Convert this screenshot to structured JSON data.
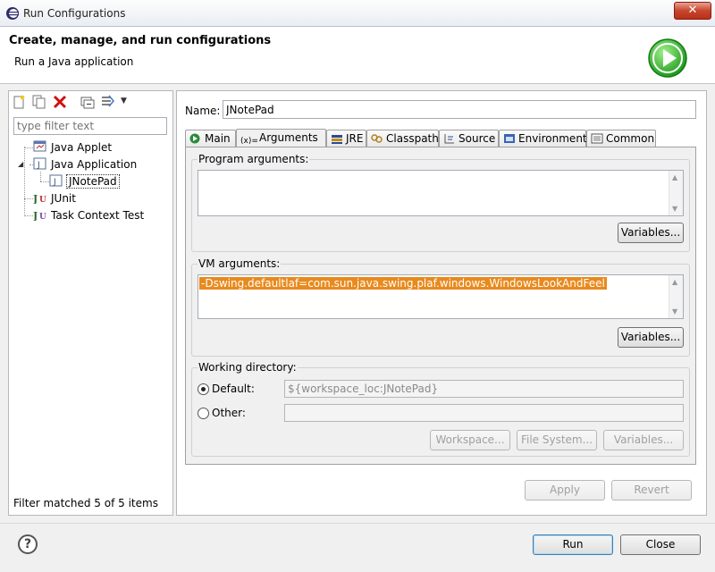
{
  "window": {
    "title": "Run Configurations"
  },
  "header": {
    "title": "Create, manage, and run configurations",
    "subtitle": "Run a Java application"
  },
  "left": {
    "filter_placeholder": "type filter text",
    "tree": [
      {
        "label": "Java Applet",
        "icon": "java-applet-icon"
      },
      {
        "label": "Java Application",
        "icon": "java-application-icon"
      },
      {
        "label": "JNotePad",
        "icon": "java-launch-icon"
      },
      {
        "label": "JUnit",
        "icon": "junit-icon"
      },
      {
        "label": "Task Context Test",
        "icon": "task-context-icon"
      }
    ],
    "status": "Filter matched 5 of 5 items"
  },
  "right": {
    "name_label": "Name:",
    "name_value": "JNotePad",
    "tabs": [
      {
        "label": "Main",
        "icon": "main-tab-icon"
      },
      {
        "label": "Arguments",
        "icon": "arguments-tab-icon"
      },
      {
        "label": "JRE",
        "icon": "jre-tab-icon"
      },
      {
        "label": "Classpath",
        "icon": "classpath-tab-icon"
      },
      {
        "label": "Source",
        "icon": "source-tab-icon"
      },
      {
        "label": "Environment",
        "icon": "environment-tab-icon"
      },
      {
        "label": "Common",
        "icon": "common-tab-icon"
      }
    ],
    "program_args_label": "Program arguments:",
    "program_args_value": "",
    "variables_label": "Variables...",
    "vm_args_label": "VM arguments:",
    "vm_args_value": "-Dswing.defaultlaf=com.sun.java.swing.plaf.windows.WindowsLookAndFeel",
    "working_dir_label": "Working directory:",
    "default_label": "Default:",
    "default_value": "${workspace_loc:JNotePad}",
    "other_label": "Other:",
    "other_value": "",
    "workspace_label": "Workspace...",
    "filesystem_label": "File System...",
    "apply_label": "Apply",
    "revert_label": "Revert"
  },
  "footer": {
    "run_label": "Run",
    "close_label": "Close"
  }
}
